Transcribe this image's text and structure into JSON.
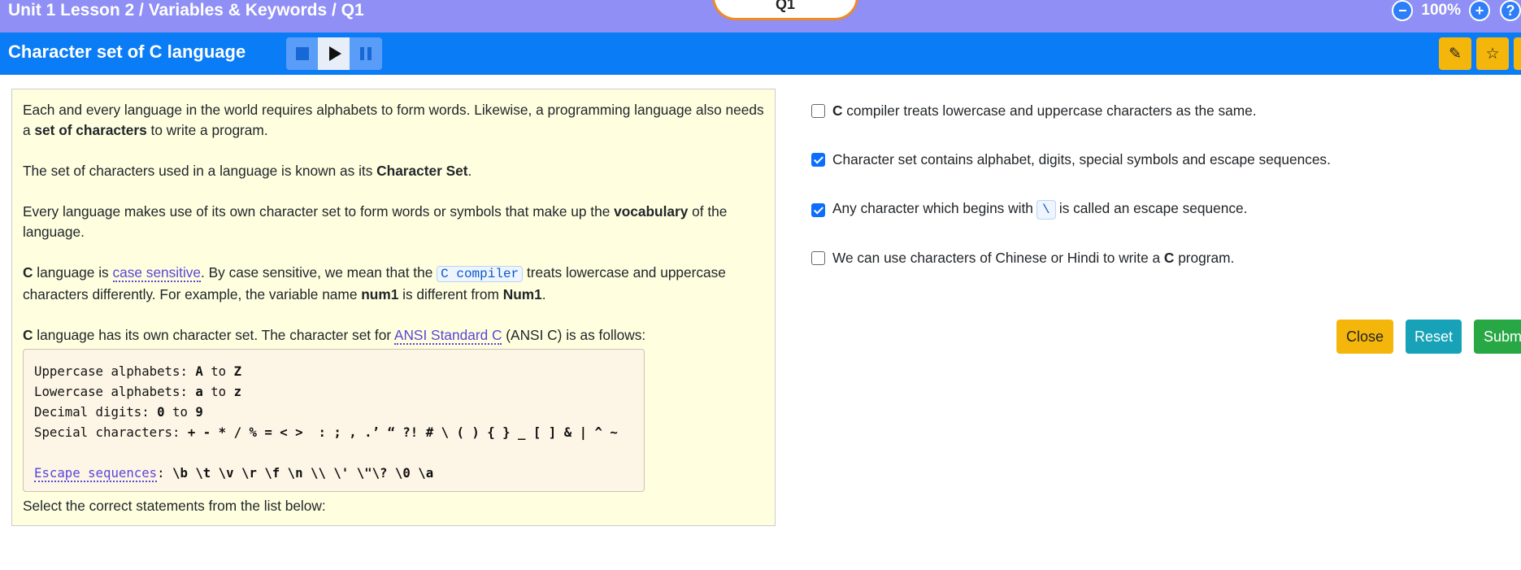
{
  "header": {
    "breadcrumb": "Unit 1 Lesson 2 / Variables & Keywords / Q1",
    "question_tab": "Q1",
    "zoom_out_icon": "minus-circle-icon",
    "zoom_level": "100%",
    "zoom_in_icon": "plus-circle-icon",
    "help_icon": "question-circle-icon"
  },
  "titlebar": {
    "title": "Character set of C language",
    "media": [
      "stop-icon",
      "play-icon",
      "pause-icon"
    ],
    "tools": [
      "pencil-icon",
      "star-icon"
    ]
  },
  "content": {
    "p1_a": "Each and every language in the world requires alphabets to form words. Likewise, a programming language also needs a ",
    "p1_b": "set of characters",
    "p1_c": " to write a program.",
    "p2_a": "The set of characters used in a language is known as its ",
    "p2_b": "Character Set",
    "p2_c": ".",
    "p3_a": "Every language makes use of its own character set to form words or symbols that make up the ",
    "p3_b": "vocabulary",
    "p3_c": " of the language.",
    "p4_a": "C",
    "p4_b": " language is ",
    "p4_link": "case sensitive",
    "p4_c": ". By case sensitive, we mean that the ",
    "p4_code": "C compiler",
    "p4_d": " treats lowercase and uppercase characters differently. For example, the variable name ",
    "p4_e": "num1",
    "p4_f": " is different from ",
    "p4_g": "Num1",
    "p4_h": ".",
    "p5_a": "C",
    "p5_b": " language has its own character set. The character set for ",
    "p5_link": "ANSI Standard C",
    "p5_c": " (ANSI C) is as follows:",
    "code": {
      "upper_label": "Uppercase alphabets: ",
      "upper_value": "A",
      "upper_to": " to ",
      "upper_end": "Z",
      "lower_label": "Lowercase alphabets: ",
      "lower_value": "a",
      "lower_to": " to ",
      "lower_end": "z",
      "digits_label": "Decimal digits: ",
      "digits_value": "0",
      "digits_to": " to ",
      "digits_end": "9",
      "special_label": "Special characters: ",
      "special_value": "+ - * / % = < >  : ; , .’ “ ?! # \\ ( ) { } _ [ ] & | ^ ~",
      "escape_link": "Escape sequences",
      "escape_colon": ": ",
      "escape_value": "\\b \\t \\v \\r \\f \\n \\\\ \\' \\\"\\? \\0 \\a"
    },
    "select_prompt": "Select the correct statements from the list below:"
  },
  "options": [
    {
      "checked": false,
      "bold_lead": "C",
      "text": " compiler treats lowercase and uppercase characters as the same."
    },
    {
      "checked": true,
      "text": "Character set contains alphabet, digits, special symbols and escape sequences."
    },
    {
      "checked": true,
      "text_a": "Any character which begins with",
      "code": "\\",
      "text_b": "is called an escape sequence."
    },
    {
      "checked": false,
      "text_a": "We can use characters of Chinese or Hindi to write a ",
      "bold": "C",
      "text_b": " program."
    }
  ],
  "buttons": {
    "close": "Close",
    "reset": "Reset",
    "submit": "Submit"
  }
}
